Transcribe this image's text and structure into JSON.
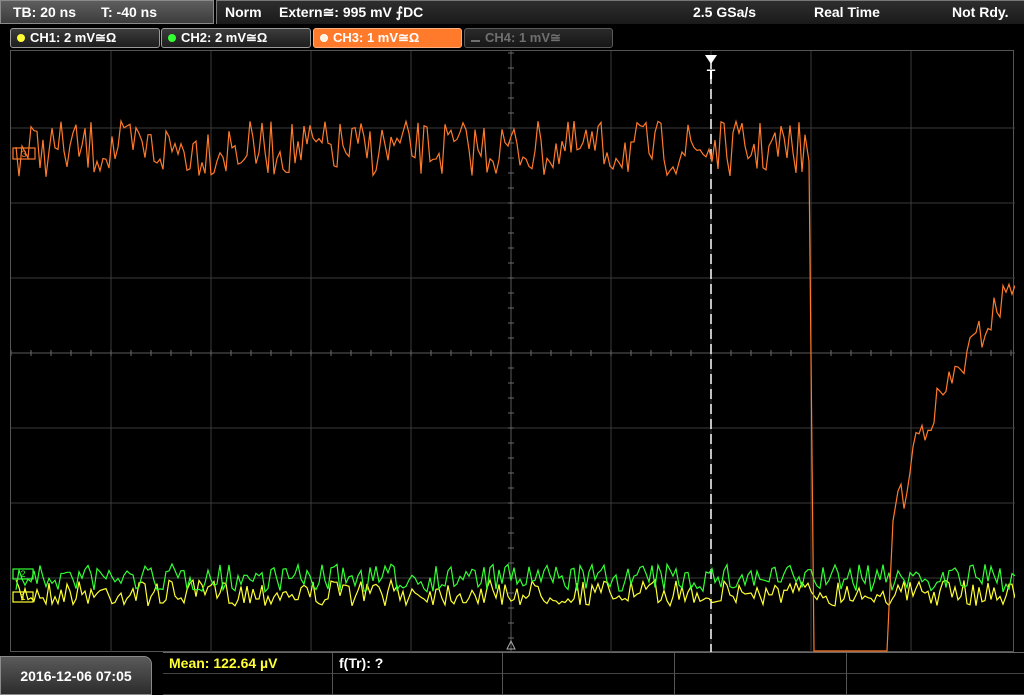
{
  "timebase": {
    "tb_label": "TB: 20 ns",
    "t_label": "T: -40 ns"
  },
  "status": {
    "mode": "Norm",
    "trigger": "Extern≅: 995 mV ⨍DC",
    "sample_rate": "2.5 GSa/s",
    "acq_mode": "Real Time",
    "ready_state": "Not Rdy."
  },
  "channels": [
    {
      "label": "CH1: 2 mV≅Ω",
      "color": "#ffff33",
      "state": "on"
    },
    {
      "label": "CH2: 2 mV≅Ω",
      "color": "#33ff33",
      "state": "on"
    },
    {
      "label": "CH3: 1 mV≅Ω",
      "color": "#ff7a2a",
      "state": "active"
    },
    {
      "label": "CH4: 1 mV≅",
      "color": "#6f6f6f",
      "state": "off"
    }
  ],
  "screen": {
    "trigger_marker": "T",
    "ch3_offset_label": "3",
    "ch2_offset_label": "2",
    "ch1_offset_label": "1"
  },
  "bottom": {
    "datetime": "2016-12-06 07:05",
    "measurements": [
      {
        "text": "Mean: 122.64 µV",
        "color": "#ffff33"
      },
      {
        "text": "f(Tr): ?",
        "color": "#ffffff"
      }
    ]
  }
}
